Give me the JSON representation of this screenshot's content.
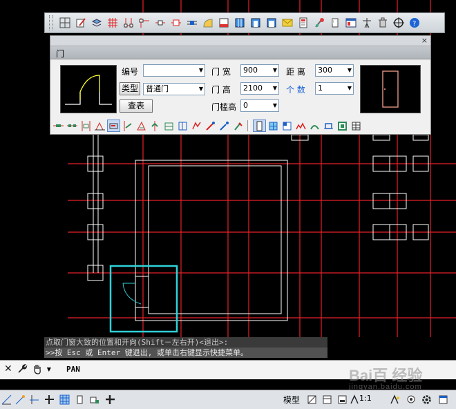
{
  "dialog": {
    "tab_label": "门",
    "number_label": "编号",
    "number_value": "",
    "type_button": "类型",
    "type_value": "普通门",
    "lookup_button": "查表",
    "width_label": "门 宽",
    "width_value": "900",
    "height_label": "门 高",
    "height_value": "2100",
    "threshold_label": "门槛高",
    "threshold_value": "0",
    "distance_label": "距 离",
    "distance_value": "300",
    "count_label": "个 数",
    "count_value": "1",
    "close_glyph": "×"
  },
  "command": {
    "prompt_line1": "点取门窗大致的位置和开向(Shift－左右开)<退出>:",
    "prompt_line2": ">>按 Esc 或 Enter 键退出, 或单击右键显示快捷菜单。",
    "input_text": "PAN",
    "close_glyph": "✕"
  },
  "status": {
    "model_label": "模型",
    "scale_label": "1:1"
  },
  "watermark": {
    "text": "Bai百 经验",
    "sub": "jingyan.baidu.com"
  },
  "colors": {
    "grid_red": "#e8202a",
    "wall_white": "#ffffff",
    "highlight_cyan": "#2fd1d8",
    "door_yellow": "#ffff33",
    "door_pink": "#f4a08a"
  },
  "icons": {
    "top_toolbar": [
      "axis-grid-icon",
      "edit-axis-icon",
      "layers-icon",
      "grid-icon",
      "column-icon",
      "wall-icon",
      "door-icon",
      "window-icon",
      "opening-icon",
      "stair-icon",
      "room-icon",
      "table-icon",
      "dimension-icon",
      "text-icon",
      "symbol-icon",
      "book-icon",
      "file-icon",
      "tool-icon",
      "delete-icon",
      "compass-icon",
      "help-icon"
    ],
    "dialog_tools": [
      "free-insert-icon",
      "along-wall-icon",
      "axis-insert-icon",
      "upper-insert-icon",
      "center-insert-icon",
      "door-window-icon",
      "corner-icon",
      "stack-icon",
      "mirror-icon",
      "gate-icon",
      "arc-icon",
      "combine-icon",
      "fill-icon",
      "pick-icon",
      "brush-icon",
      "door-type-icon",
      "window-type-icon",
      "bay-icon",
      "flat-icon",
      "arc-door-icon",
      "frame-icon",
      "select-icon",
      "table-view-icon"
    ],
    "status_tools": [
      "snap-icon",
      "ortho-icon",
      "polar-icon",
      "osnap-icon",
      "grid-display-icon",
      "model-space-icon",
      "layout-icon",
      "quick-view-icon",
      "annotation-icon",
      "lock-icon",
      "settings-icon",
      "maximize-icon"
    ]
  }
}
